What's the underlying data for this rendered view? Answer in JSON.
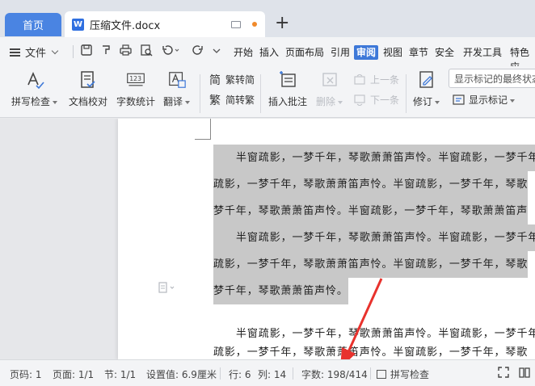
{
  "tabs": {
    "home": "首页",
    "doc_name": "压缩文件.docx",
    "doc_icon_letter": "W",
    "add": "+"
  },
  "menu": {
    "file": "文件",
    "items": [
      "开始",
      "插入",
      "页面布局",
      "引用",
      "审阅",
      "视图",
      "章节",
      "安全",
      "开发工具",
      "特色应"
    ],
    "active": "审阅"
  },
  "ribbon": {
    "spellcheck": "拼写检查",
    "proofread": "文档校对",
    "wordcount": "字数统计",
    "translate": "翻译",
    "trad": "繁转简",
    "simp": "简转繁",
    "insert_comment": "插入批注",
    "delete": "删除",
    "prev": "上一条",
    "next": "下一条",
    "revise": "修订",
    "show_markup_select": "显示标记的最终状态",
    "show_markup": "显示标记",
    "icon_123": "123"
  },
  "document": {
    "lines": [
      "半窗疏影，一梦千年，琴歌萧萧笛声怜。半窗疏影，一梦千年",
      "疏影，一梦千年，琴歌萧萧笛声怜。半窗疏影，一梦千年，琴歌",
      "梦千年，琴歌萧萧笛声怜。半窗疏影，一梦千年，琴歌萧萧笛声",
      "半窗疏影，一梦千年，琴歌萧萧笛声怜。半窗疏影，一梦千年",
      "疏影，一梦千年，琴歌萧萧笛声怜。半窗疏影，一梦千年，琴歌",
      "梦千年，琴歌萧萧笛声怜。",
      "半窗疏影，一梦千年，琴歌萧萧笛声怜。半窗疏影，一梦千年",
      "疏影，一梦千年，琴歌萧萧笛声怜。半窗疏影，一梦千年，琴歌"
    ]
  },
  "status": {
    "page_code": "页码: 1",
    "page": "页面: 1/1",
    "section": "节: 1/1",
    "setting": "设置值: 6.9厘米",
    "row": "行: 6",
    "col": "列: 14",
    "word_count": "字数: 198/414",
    "spell": "拼写检查"
  },
  "colors": {
    "accent": "#3d78d8",
    "home_tab": "#4a84e2",
    "selection": "#c8c8c8",
    "arrow": "#e8322d"
  }
}
